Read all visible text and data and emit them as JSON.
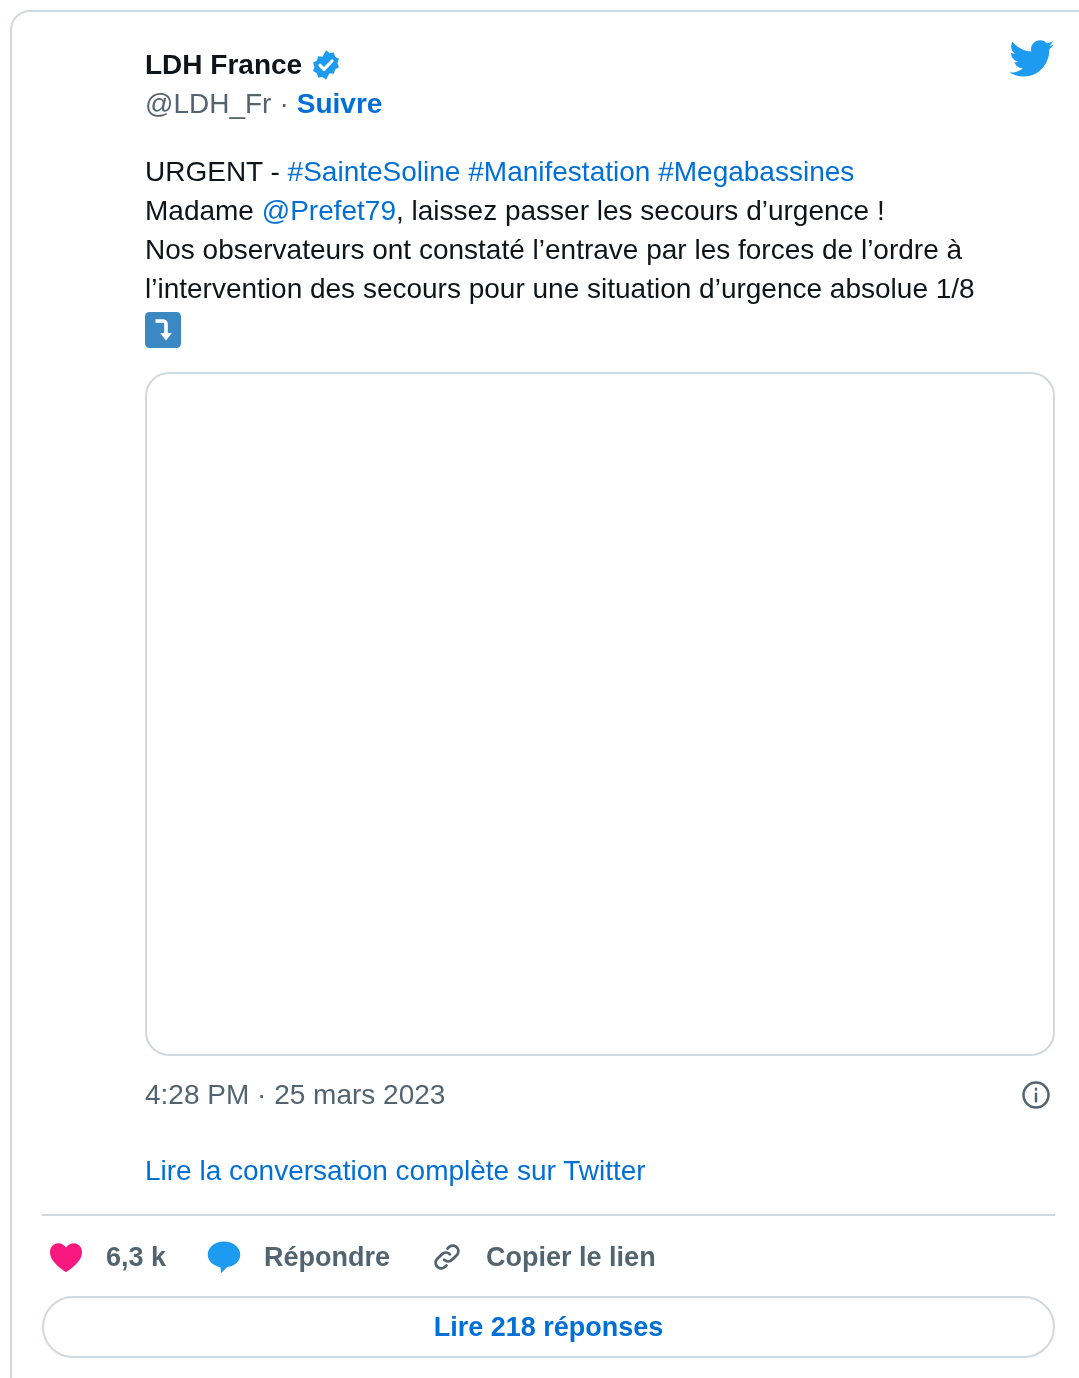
{
  "author": {
    "name": "LDH France",
    "verified": true,
    "handle": "@LDH_Fr",
    "separator": "·",
    "follow": "Suivre"
  },
  "tweet": {
    "lines": [
      [
        {
          "kind": "text",
          "text": "URGENT - "
        },
        {
          "kind": "link",
          "text": "#SainteSoline"
        },
        {
          "kind": "link",
          "text": "#Manifestation",
          "space_before": true
        },
        {
          "kind": "link",
          "text": "#Megabassines",
          "space_before": true
        }
      ],
      [
        {
          "kind": "text",
          "text": "Madame "
        },
        {
          "kind": "link",
          "text": "@Prefet79"
        },
        {
          "kind": "text",
          "text": ", laissez passer les secours d’urgence !"
        }
      ],
      [
        {
          "kind": "text",
          "text": "Nos observateurs ont constaté l’entrave par les forces de l’ordre à"
        }
      ],
      [
        {
          "kind": "text",
          "text": "l’intervention des secours pour une situation d’urgence absolue 1/8"
        }
      ]
    ]
  },
  "timestamp": "4:28 PM · 25 mars 2023",
  "conversation_link": "Lire la conversation complète sur Twitter",
  "actions": [
    {
      "kind": "like",
      "label": "6,3 k"
    },
    {
      "kind": "reply",
      "label": "Répondre"
    },
    {
      "kind": "copy",
      "label": "Copier le lien"
    }
  ],
  "replies_button": "Lire 218 réponses"
}
